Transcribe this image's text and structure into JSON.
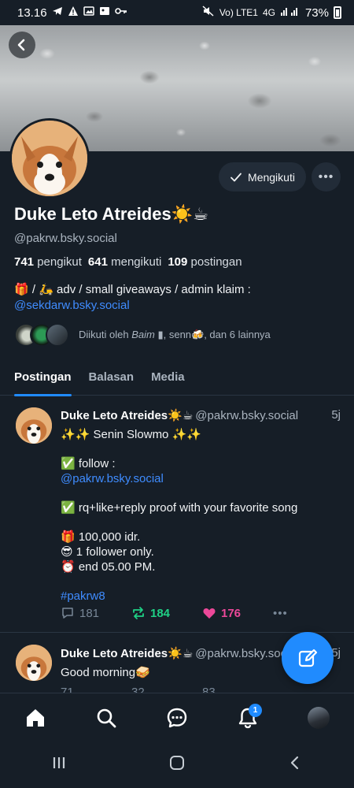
{
  "status_bar": {
    "time": "13.16",
    "network": "Vo) LTE1",
    "signal": "4G",
    "battery": "73%",
    "icons": [
      "telegram-icon",
      "warning-icon",
      "image-icon",
      "gallery-icon",
      "key-icon",
      "mute-icon",
      "signal-icon"
    ]
  },
  "profile": {
    "name": "Duke Leto Atreides☀️☕",
    "handle": "@pakrw.bsky.social",
    "follow_button": "Mengikuti",
    "stats": {
      "followers_count": "741",
      "followers_label": "pengikut",
      "following_count": "641",
      "following_label": "mengikuti",
      "posts_count": "109",
      "posts_label": "postingan"
    },
    "bio_line1": "🎁 / 🛵 adv / small giveaways / admin klaim :",
    "bio_link": "@sekdarw.bsky.social",
    "followed_by_prefix": "Diikuti oleh",
    "followed_by_name1": "Baim ▮",
    "followed_by_rest": ", senn🍻, dan 6 lainnya"
  },
  "tabs": [
    {
      "label": "Postingan",
      "active": true
    },
    {
      "label": "Balasan",
      "active": false
    },
    {
      "label": "Media",
      "active": false
    }
  ],
  "posts": [
    {
      "name": "Duke Leto Atreides☀️☕",
      "handle": "@pakrw.bsky.social",
      "time": "5j",
      "line1": "✨✨ Senin Slowmo ✨✨",
      "line2": "✅ follow :",
      "line3": "@pakrw.bsky.social",
      "line4": "✅ rq+like+reply proof with your favorite song",
      "line5": "🎁 100,000 idr.",
      "line6": "😎 1 follower only.",
      "line7": "⏰  end 05.00 PM.",
      "line8": "#pakrw8",
      "replies": "181",
      "reposts": "184",
      "likes": "176"
    },
    {
      "name": "Duke Leto Atreides☀️☕",
      "handle": "@pakrw.bsky.social",
      "time": "5j",
      "line1": "Good morning🥪",
      "replies": "71",
      "reposts": "32",
      "likes": "83"
    }
  ],
  "bottom_nav": {
    "items": [
      "home-icon",
      "search-icon",
      "chat-icon",
      "notifications-icon",
      "profile-avatar"
    ],
    "notification_badge": "1"
  },
  "colors": {
    "background": "#161e27",
    "accent": "#208bfe",
    "repost": "#1fd085",
    "like": "#ec4899",
    "link": "#3f8cff"
  }
}
